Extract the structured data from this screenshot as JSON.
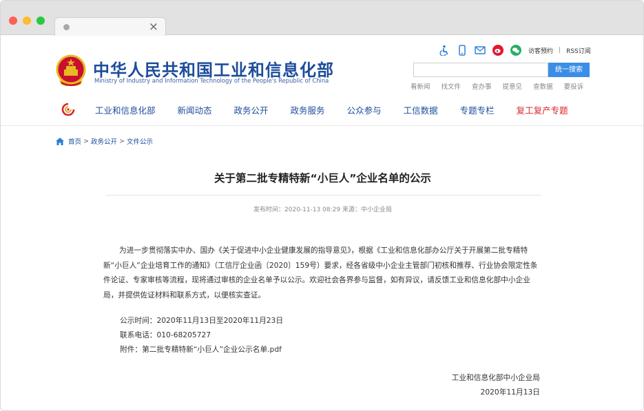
{
  "browser": {
    "tab_close": "×"
  },
  "header": {
    "title": "中华人民共和国工业和信息化部",
    "subtitle": "Ministry of Industry and Information Technology of the People's Republic of China",
    "top_links": {
      "visitor": "访客预约",
      "separator": "|",
      "rss": "RSS订阅"
    },
    "search": {
      "placeholder": "",
      "button": "统一搜索"
    },
    "quick_links": [
      "看新闻",
      "找文件",
      "查办事",
      "提意见",
      "查数据",
      "要投诉"
    ],
    "icons": [
      "accessibility-icon",
      "mobile-icon",
      "mail-icon",
      "weibo-icon",
      "wechat-icon"
    ]
  },
  "nav": {
    "items": [
      "工业和信息化部",
      "新闻动态",
      "政务公开",
      "政务服务",
      "公众参与",
      "工信数据",
      "专题专栏",
      "复工复产专题"
    ]
  },
  "breadcrumb": {
    "home": "首页",
    "sep": ">",
    "level1": "政务公开",
    "level2": "文件公示"
  },
  "article": {
    "title": "关于第二批专精特新“小巨人”企业名单的公示",
    "meta": "发布时间：2020-11-13 08:29  来源：中小企业局",
    "body": "为进一步贯彻落实中办、国办《关于促进中小企业健康发展的指导意见》，根据《工业和信息化部办公厅关于开展第二批专精特新“小巨人”企业培育工作的通知》（工信厅企业函〔2020〕159号）要求，经各省级中小企业主管部门初核和推荐、行业协会限定性条件论证、专家审核等流程，现将通过审核的企业名单予以公示。欢迎社会各界参与监督，如有异议，请反馈工业和信息化部中小企业局，并提供佐证材料和联系方式，以便核实查证。",
    "period": "公示时间：2020年11月13日至2020年11月23日",
    "phone": "联系电话：010-68205727",
    "attachment_label": "附件：",
    "attachment": "第二批专精特新“小巨人”企业公示名单.pdf",
    "signature_org": "工业和信息化部中小企业局",
    "signature_date": "2020年11月13日"
  },
  "colors": {
    "brand_blue": "#1c4c9c",
    "accent_red": "#d9262c",
    "search_blue": "#3a8ee6"
  }
}
